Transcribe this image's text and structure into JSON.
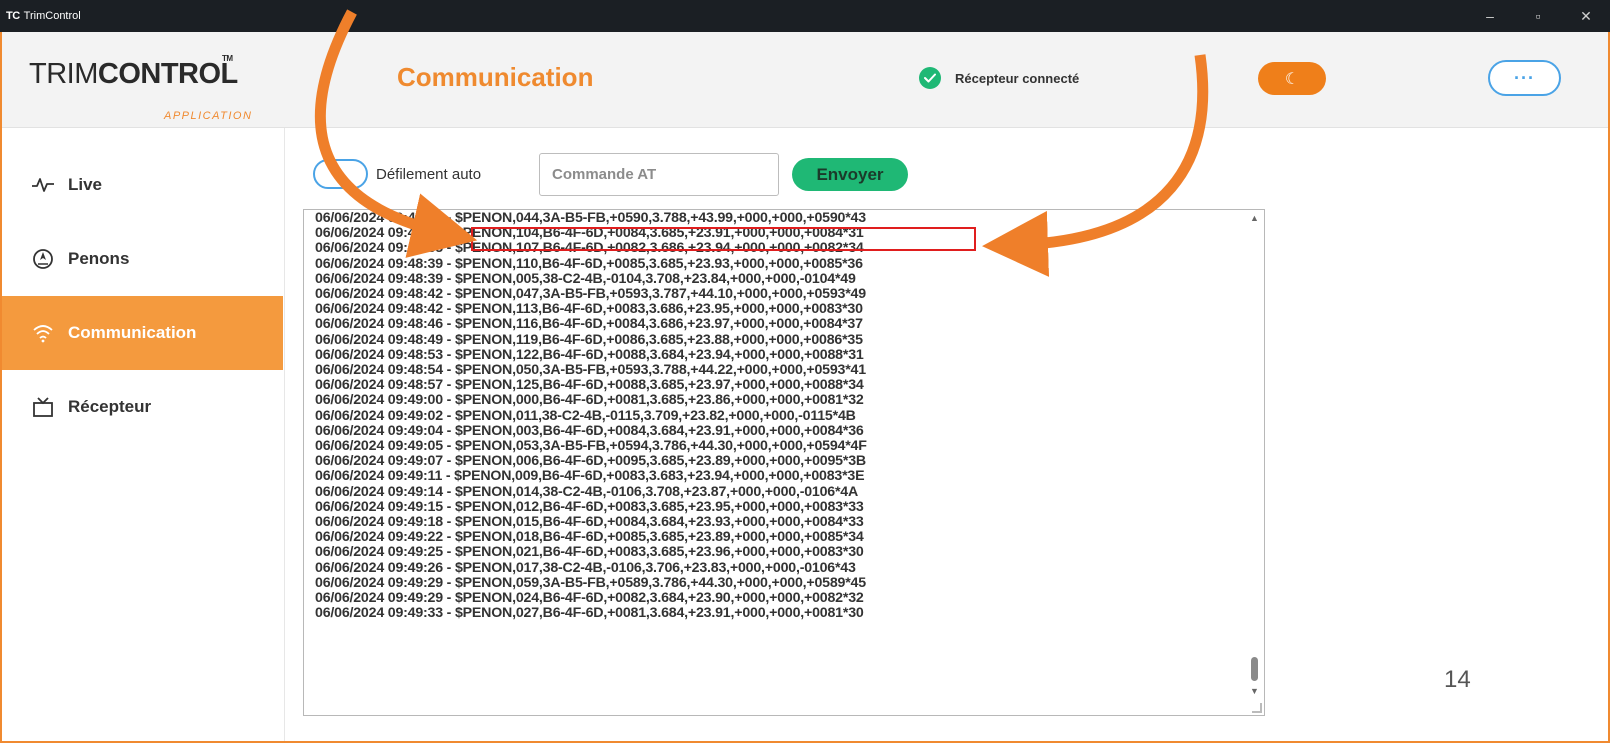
{
  "window": {
    "app_icon": "TC",
    "title": "TrimControl",
    "controls": [
      "–",
      "▫",
      "✕"
    ]
  },
  "header": {
    "brand_light": "TRIM",
    "brand_bold": "CONTROL",
    "brand_tm": "TM",
    "brand_sub": "APPLICATION",
    "page_title": "Communication",
    "status_text": "Récepteur connecté",
    "status_color": "#1fb875",
    "accent_color": "#ef8a2f",
    "theme_icon": "☾",
    "more_icon": "···"
  },
  "sidebar": {
    "items": [
      {
        "label": "Live",
        "icon": "pulse-icon",
        "active": false
      },
      {
        "label": "Penons",
        "icon": "compass-icon",
        "active": false
      },
      {
        "label": "Communication",
        "icon": "wifi-icon",
        "active": true
      },
      {
        "label": "Récepteur",
        "icon": "receiver-icon",
        "active": false
      }
    ]
  },
  "controls": {
    "autoscroll_label": "Défilement auto",
    "command_placeholder": "Commande AT",
    "send_label": "Envoyer"
  },
  "log": {
    "lines": [
      "06/06/2024 09:48:30 - $PENON,044,3A-B5-FB,+0590,3.788,+43.99,+000,+000,+0590*43",
      "06/06/2024 09:48:31 - $PENON,104,B6-4F-6D,+0084,3.685,+23.91,+000,+000,+0084*31",
      "06/06/2024 09:48:35 - $PENON,107,B6-4F-6D,+0082,3.686,+23.94,+000,+000,+0082*34",
      "06/06/2024 09:48:39 - $PENON,110,B6-4F-6D,+0085,3.685,+23.93,+000,+000,+0085*36",
      "06/06/2024 09:48:39 - $PENON,005,38-C2-4B,-0104,3.708,+23.84,+000,+000,-0104*49",
      "06/06/2024 09:48:42 - $PENON,047,3A-B5-FB,+0593,3.787,+44.10,+000,+000,+0593*49",
      "06/06/2024 09:48:42 - $PENON,113,B6-4F-6D,+0083,3.686,+23.95,+000,+000,+0083*30",
      "06/06/2024 09:48:46 - $PENON,116,B6-4F-6D,+0084,3.686,+23.97,+000,+000,+0084*37",
      "06/06/2024 09:48:49 - $PENON,119,B6-4F-6D,+0086,3.685,+23.88,+000,+000,+0086*35",
      "06/06/2024 09:48:53 - $PENON,122,B6-4F-6D,+0088,3.684,+23.94,+000,+000,+0088*31",
      "06/06/2024 09:48:54 - $PENON,050,3A-B5-FB,+0593,3.788,+44.22,+000,+000,+0593*41",
      "06/06/2024 09:48:57 - $PENON,125,B6-4F-6D,+0088,3.685,+23.97,+000,+000,+0088*34",
      "06/06/2024 09:49:00 - $PENON,000,B6-4F-6D,+0081,3.685,+23.86,+000,+000,+0081*32",
      "06/06/2024 09:49:02 - $PENON,011,38-C2-4B,-0115,3.709,+23.82,+000,+000,-0115*4B",
      "06/06/2024 09:49:04 - $PENON,003,B6-4F-6D,+0084,3.684,+23.91,+000,+000,+0084*36",
      "06/06/2024 09:49:05 - $PENON,053,3A-B5-FB,+0594,3.786,+44.30,+000,+000,+0594*4F",
      "06/06/2024 09:49:07 - $PENON,006,B6-4F-6D,+0095,3.685,+23.89,+000,+000,+0095*3B",
      "06/06/2024 09:49:11 - $PENON,009,B6-4F-6D,+0083,3.683,+23.94,+000,+000,+0083*3E",
      "06/06/2024 09:49:14 - $PENON,014,38-C2-4B,-0106,3.708,+23.87,+000,+000,-0106*4A",
      "06/06/2024 09:49:15 - $PENON,012,B6-4F-6D,+0083,3.685,+23.95,+000,+000,+0083*33",
      "06/06/2024 09:49:18 - $PENON,015,B6-4F-6D,+0084,3.684,+23.93,+000,+000,+0084*33",
      "06/06/2024 09:49:22 - $PENON,018,B6-4F-6D,+0085,3.685,+23.89,+000,+000,+0085*34",
      "06/06/2024 09:49:25 - $PENON,021,B6-4F-6D,+0083,3.685,+23.96,+000,+000,+0083*30",
      "06/06/2024 09:49:26 - $PENON,017,38-C2-4B,-0106,3.706,+23.83,+000,+000,-0106*43",
      "06/06/2024 09:49:29 - $PENON,059,3A-B5-FB,+0589,3.786,+44.30,+000,+000,+0589*45",
      "06/06/2024 09:49:29 - $PENON,024,B6-4F-6D,+0082,3.684,+23.90,+000,+000,+0082*32",
      "06/06/2024 09:49:33 - $PENON,027,B6-4F-6D,+0081,3.684,+23.91,+000,+000,+0081*30"
    ],
    "highlight_color": "#e01e1e"
  },
  "annotation": {
    "arrow_color": "#ef7f2a",
    "page_number": "14"
  }
}
